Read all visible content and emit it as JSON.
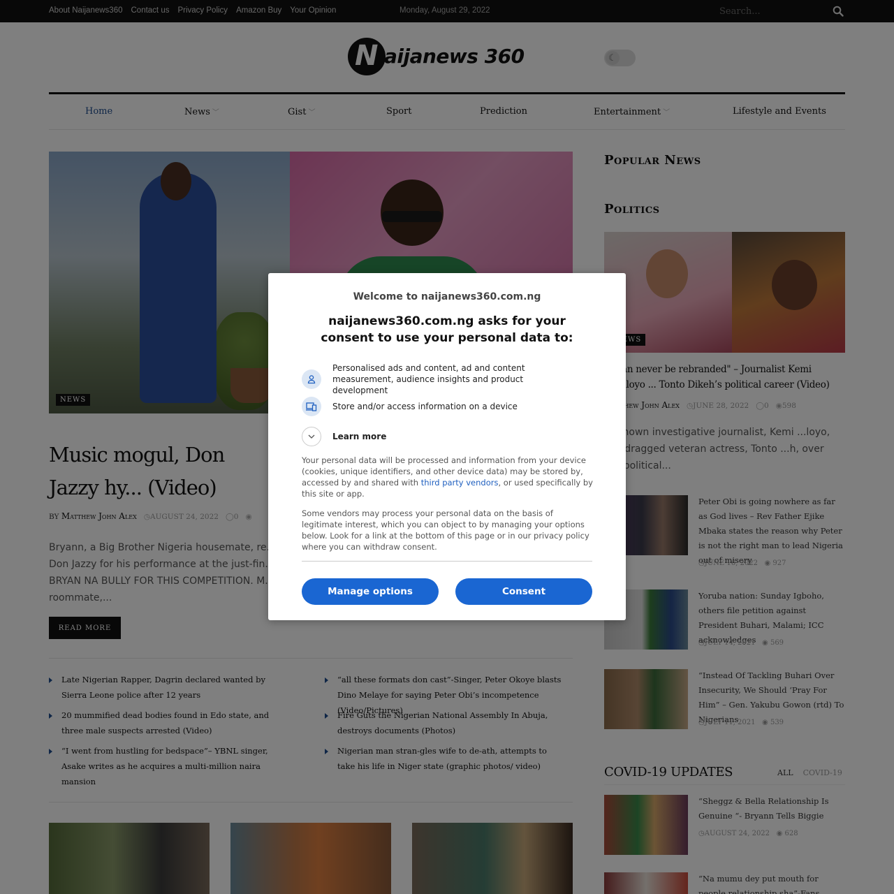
{
  "topbar": {
    "links": [
      "About Naijanews360",
      "Contact us",
      "Privacy Policy",
      "Amazon Buy",
      "Your Opinion"
    ],
    "date": "Monday, August 29, 2022",
    "search_placeholder": "Search..."
  },
  "logo": {
    "mark": "N",
    "text": "aijanews 360"
  },
  "nav": {
    "items": [
      {
        "label": "Home",
        "active": true,
        "dropdown": false
      },
      {
        "label": "News",
        "active": false,
        "dropdown": true
      },
      {
        "label": "Gist",
        "active": false,
        "dropdown": true
      },
      {
        "label": "Sport",
        "active": false,
        "dropdown": false
      },
      {
        "label": "Prediction",
        "active": false,
        "dropdown": false
      },
      {
        "label": "Entertainment",
        "active": false,
        "dropdown": true
      },
      {
        "label": "Lifestyle and Events",
        "active": false,
        "dropdown": false
      }
    ]
  },
  "hero": {
    "category": "NEWS",
    "headline": "Music mogul, Don Jazzy hy... (Video)",
    "by": "BY",
    "author": "Matthew John Alex",
    "date": "AUGUST 24, 2022",
    "comments": "0",
    "excerpt": "Bryann, a Big Brother Nigeria housemate, re... Don Jazzy for his performance at the just-fin... BRYAN NA BULLY FOR THIS COMPETITION. M... roommate,...",
    "read_more": "READ MORE"
  },
  "related": [
    "Late Nigerian Rapper, Dagrin declared wanted by Sierra Leone police after 12 years",
    "“all these formats don cast”-Singer, Peter Okoye blasts Dino Melaye for saying Peter Obi’s incompetence (Video/Pictures)",
    "20 mummified dead bodies found in Edo state, and three male suspects arrested (Video)",
    "Fire Guts the Nigerian National Assembly In Abuja, destroys documents (Photos)",
    "“I went from hustling for bedspace”– YBNL singer, Asake writes as he acquires a multi-million naira mansion",
    "Nigerian man stran-gles wife to de-ath, attempts to take his life in Niger state (graphic photos/ video)"
  ],
  "sidebar": {
    "popular_title": "Popular News",
    "politics_title": "Politics",
    "politics_category": "NEWS",
    "politics_headline": "\"...can never be rebranded\" – Journalist Kemi Olunloyo ... Tonto Dikeh’s political career (Video)",
    "politics_author": "Matthew John Alex",
    "politics_date": "JUNE 28, 2022",
    "politics_comments": "0",
    "politics_views": "598",
    "politics_excerpt": "...-known investigative journalist, Kemi ...loyo, has dragged veteran actress, Tonto ...h, over her political...",
    "items": [
      {
        "title": "Peter Obi is going nowhere as far as God lives – Rev Father Ejike Mbaka states the reason why Peter is not the right man to lead Nigeria out of misery",
        "date": "JUNE 16, 2022",
        "views": "927"
      },
      {
        "title": "Yoruba nation: Sunday Igboho, others file petition against President Buhari, Malami; ICC acknowledges",
        "date": "JULY 14, 2021",
        "views": "569"
      },
      {
        "title": "“Instead Of Tackling Buhari Over Insecurity, We Should ‘Pray For Him” – Gen. Yakubu Gowon (rtd) To Nigerians",
        "date": "JULY 11, 2021",
        "views": "539"
      }
    ],
    "covid_title": "COVID-19 UPDATES",
    "covid_tabs": [
      "ALL",
      "COVID-19"
    ],
    "covid_items": [
      {
        "title": "“Sheggz & Bella Relationship Is Genuine “- Bryann Tells Biggie",
        "date": "AUGUST 24, 2022",
        "views": "628"
      },
      {
        "title": "“Na mumu dey put mouth for people relationship sha”-Fans gushes as TC..."
      }
    ]
  },
  "consent": {
    "welcome": "Welcome to naijanews360.com.ng",
    "ask": "naijanews360.com.ng asks for your consent to use your personal data to:",
    "purpose1": "Personalised ads and content, ad and content measurement, audience insights and product development",
    "purpose2": "Store and/or access information on a device",
    "learn_more": "Learn more",
    "para1_a": "Your personal data will be processed and information from your device (cookies, unique identifiers, and other device data) may be stored by, accessed by and shared with ",
    "para1_link": "third party vendors",
    "para1_b": ", or used specifically by this site or app.",
    "para2": "Some vendors may process your personal data on the basis of legitimate interest, which you can object to by managing your options below. Look for a link at the bottom of this page or in our privacy policy where you can withdraw consent.",
    "manage": "Manage options",
    "consent": "Consent"
  },
  "colors": {
    "accent": "#1f4d8f",
    "button_blue": "#1a66d2",
    "topbar": "#111111"
  }
}
